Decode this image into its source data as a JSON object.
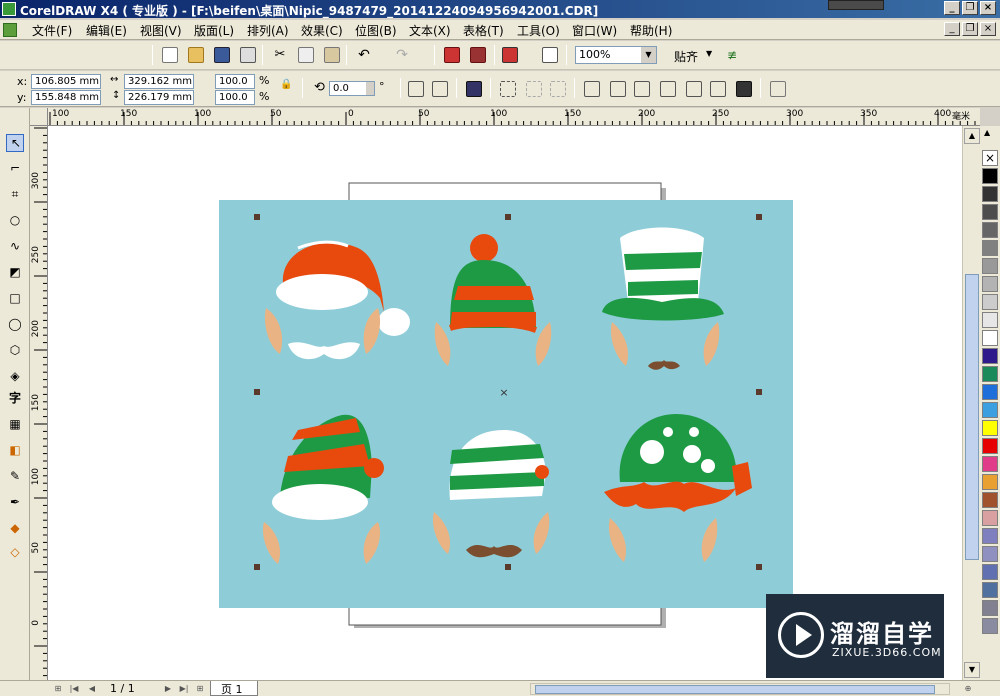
{
  "window": {
    "title": "CorelDRAW X4 ( 专业版 ) - [F:\\beifen\\桌面\\Nipic_9487479_20141224094956942001.CDR]"
  },
  "menu": [
    {
      "label": "文件(F)"
    },
    {
      "label": "编辑(E)"
    },
    {
      "label": "视图(V)"
    },
    {
      "label": "版面(L)"
    },
    {
      "label": "排列(A)"
    },
    {
      "label": "效果(C)"
    },
    {
      "label": "位图(B)"
    },
    {
      "label": "文本(X)"
    },
    {
      "label": "表格(T)"
    },
    {
      "label": "工具(O)"
    },
    {
      "label": "窗口(W)"
    },
    {
      "label": "帮助(H)"
    }
  ],
  "toolbar": {
    "zoom_value": "100%",
    "snap_label": "贴齐"
  },
  "properties": {
    "x_label": "x:",
    "x_value": "106.805 mm",
    "y_label": "y:",
    "y_value": "155.848 mm",
    "width_value": "329.162 mm",
    "height_value": "226.179 mm",
    "scale_x": "100.0",
    "scale_y": "100.0",
    "percent_symbol": "%",
    "rotation_value": "0.0",
    "degree_symbol": "°"
  },
  "rulers": {
    "h_ticks": [
      "100",
      "150",
      "100",
      "50",
      "0",
      "50",
      "100",
      "150",
      "200",
      "250",
      "300",
      "350",
      "400"
    ],
    "h_unit": "毫米",
    "v_ticks": [
      "300",
      "250",
      "200",
      "150",
      "100",
      "50",
      "0"
    ]
  },
  "status": {
    "page_count": "1 / 1",
    "page_tab": "页 1"
  },
  "watermark": {
    "brand": "溜溜自学",
    "url": "ZIXUE.3D66.COM"
  },
  "colors": {
    "artboard": "#8ecdd8",
    "hat_red": "#e84a0e",
    "hat_green": "#1e9a45",
    "ear": "#e9b383",
    "mustache": "#7a4e2e"
  }
}
